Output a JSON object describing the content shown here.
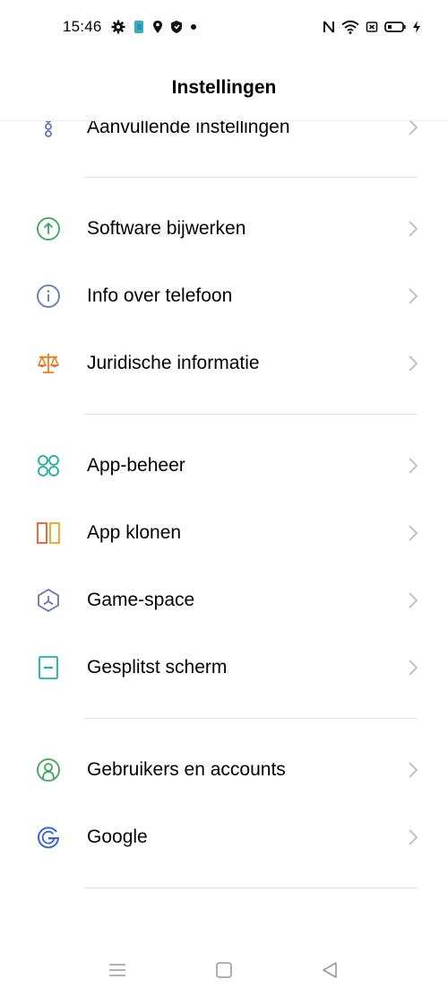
{
  "status_bar": {
    "time": "15:46",
    "left_icons": [
      "gear-icon",
      "app-notification-icon",
      "location-icon",
      "shield-icon",
      "dot-icon"
    ],
    "right_icons": [
      "nfc-icon",
      "wifi-icon",
      "battery-saver-icon",
      "battery-icon",
      "charging-bolt-icon"
    ]
  },
  "header": {
    "title": "Instellingen"
  },
  "sections": [
    {
      "items": [
        {
          "label": "Aanvullende instellingen",
          "icon": "more-settings-icon"
        }
      ]
    },
    {
      "items": [
        {
          "label": "Software bijwerken",
          "icon": "software-update-icon"
        },
        {
          "label": "Info over telefoon",
          "icon": "info-icon"
        },
        {
          "label": "Juridische informatie",
          "icon": "scales-icon"
        }
      ]
    },
    {
      "items": [
        {
          "label": "App-beheer",
          "icon": "app-management-icon"
        },
        {
          "label": "App klonen",
          "icon": "app-clone-icon"
        },
        {
          "label": "Game-space",
          "icon": "game-space-icon"
        },
        {
          "label": "Gesplitst scherm",
          "icon": "split-screen-icon"
        }
      ]
    },
    {
      "items": [
        {
          "label": "Gebruikers en accounts",
          "icon": "user-icon"
        },
        {
          "label": "Google",
          "icon": "google-icon"
        }
      ]
    }
  ],
  "nav_bar": {
    "buttons": [
      "menu-icon",
      "home-icon",
      "back-icon"
    ]
  },
  "colors": {
    "green": "#3aa859",
    "blue": "#5d77b8",
    "orange": "#f07a12",
    "teal": "#1fae9f",
    "red": "#ea5a2c",
    "purple": "#6a73b4",
    "google_blue": "#3a63d8",
    "chevron": "#bdbdbd"
  }
}
